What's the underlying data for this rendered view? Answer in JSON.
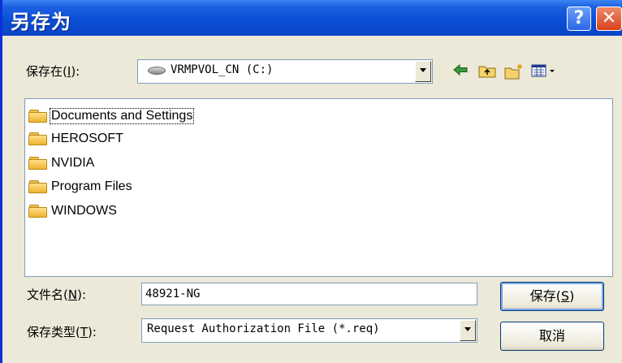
{
  "window": {
    "title": "另存为",
    "help_glyph": "?",
    "close_glyph": "✕"
  },
  "save_in": {
    "label": "保存在",
    "key": "I",
    "drive_text": "VRMPVOL_CN  (C:)",
    "drive_icon": "hard-drive-icon"
  },
  "toolbar": {
    "icons": [
      "back-arrow-icon",
      "up-folder-icon",
      "new-folder-icon",
      "view-menu-icon"
    ]
  },
  "files": [
    {
      "name": "Documents and Settings",
      "icon": "folder-icon",
      "focused": true
    },
    {
      "name": "HEROSOFT",
      "icon": "folder-icon"
    },
    {
      "name": "NVIDIA",
      "icon": "folder-icon"
    },
    {
      "name": "Program Files",
      "icon": "folder-icon"
    },
    {
      "name": "WINDOWS",
      "icon": "folder-icon"
    }
  ],
  "filename": {
    "label": "文件名",
    "key": "N",
    "value": "48921-NG"
  },
  "filetype": {
    "label": "保存类型",
    "key": "T",
    "value": "Request Authorization File (*.req)"
  },
  "buttons": {
    "save": "保存",
    "save_key": "S",
    "cancel": "取消"
  }
}
